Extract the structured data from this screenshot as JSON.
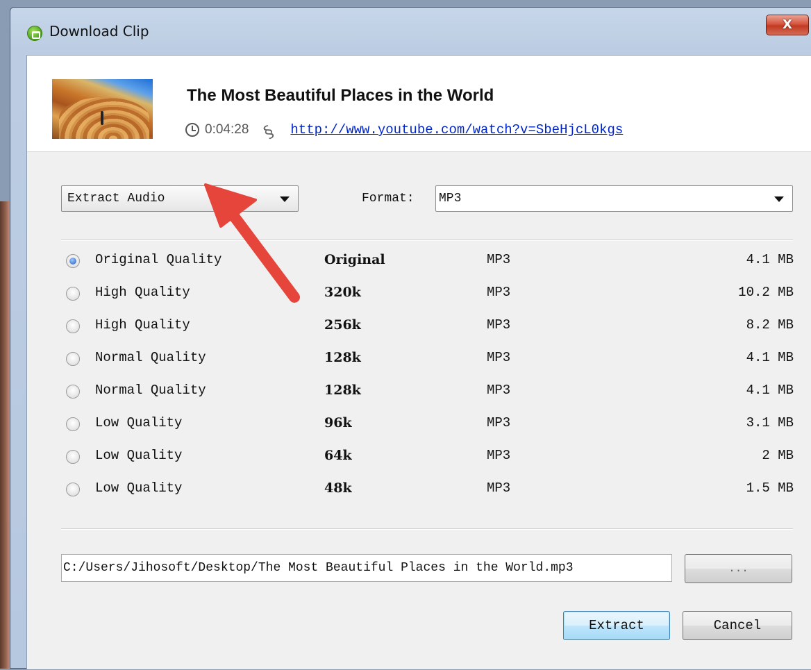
{
  "window": {
    "title": "Download Clip",
    "close_label": "X"
  },
  "video": {
    "title": "The Most Beautiful Places in the World",
    "duration": "0:04:28",
    "url": "http://www.youtube.com/watch?v=SbeHjcL0kgs"
  },
  "mode_select": {
    "value": "Extract Audio"
  },
  "format": {
    "label": "Format:",
    "value": "MP3"
  },
  "qualities": [
    {
      "label": "Original Quality",
      "bitrate": "Original",
      "format": "MP3",
      "size": "4.1 MB",
      "selected": true
    },
    {
      "label": "High Quality",
      "bitrate": "320k",
      "format": "MP3",
      "size": "10.2 MB",
      "selected": false
    },
    {
      "label": "High Quality",
      "bitrate": "256k",
      "format": "MP3",
      "size": "8.2 MB",
      "selected": false
    },
    {
      "label": "Normal Quality",
      "bitrate": "128k",
      "format": "MP3",
      "size": "4.1 MB",
      "selected": false
    },
    {
      "label": "Normal Quality",
      "bitrate": "128k",
      "format": "MP3",
      "size": "4.1 MB",
      "selected": false
    },
    {
      "label": "Low Quality",
      "bitrate": "96k",
      "format": "MP3",
      "size": "3.1 MB",
      "selected": false
    },
    {
      "label": "Low Quality",
      "bitrate": "64k",
      "format": "MP3",
      "size": "2 MB",
      "selected": false
    },
    {
      "label": "Low Quality",
      "bitrate": "48k",
      "format": "MP3",
      "size": "1.5 MB",
      "selected": false
    }
  ],
  "output": {
    "path": "C:/Users/Jihosoft/Desktop/The Most Beautiful Places in the World.mp3",
    "browse_label": "..."
  },
  "actions": {
    "extract_label": "Extract",
    "cancel_label": "Cancel"
  },
  "colors": {
    "annotation_arrow": "#e5453b",
    "link": "#0026c7"
  }
}
